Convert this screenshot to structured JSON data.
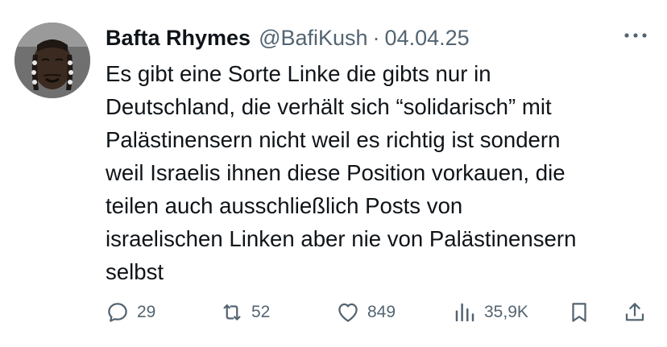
{
  "tweet": {
    "author_name": "Bafta Rhymes",
    "handle": "@BafiKush",
    "separator": "·",
    "date": "04.04.25",
    "text_lines": [
      "Es gibt eine Sorte Linke die gibts nur in",
      "Deutschland, die verhält sich “solidarisch” mit",
      "Palästinensern nicht weil es richtig ist sondern",
      "weil Israelis ihnen diese Position vorkauen, die",
      "teilen auch ausschließlich Posts von",
      "israelischen Linken aber nie von Palästinensern",
      "selbst"
    ]
  },
  "actions": {
    "replies": "29",
    "reposts": "52",
    "likes": "849",
    "views": "35,9K"
  },
  "icons": {
    "more": "more-dots-icon",
    "reply": "reply-icon",
    "repost": "repost-icon",
    "like": "heart-icon",
    "views": "views-icon",
    "bookmark": "bookmark-icon",
    "share": "share-icon"
  },
  "colors": {
    "text": "#0f1419",
    "secondary": "#536471",
    "background": "#ffffff"
  }
}
